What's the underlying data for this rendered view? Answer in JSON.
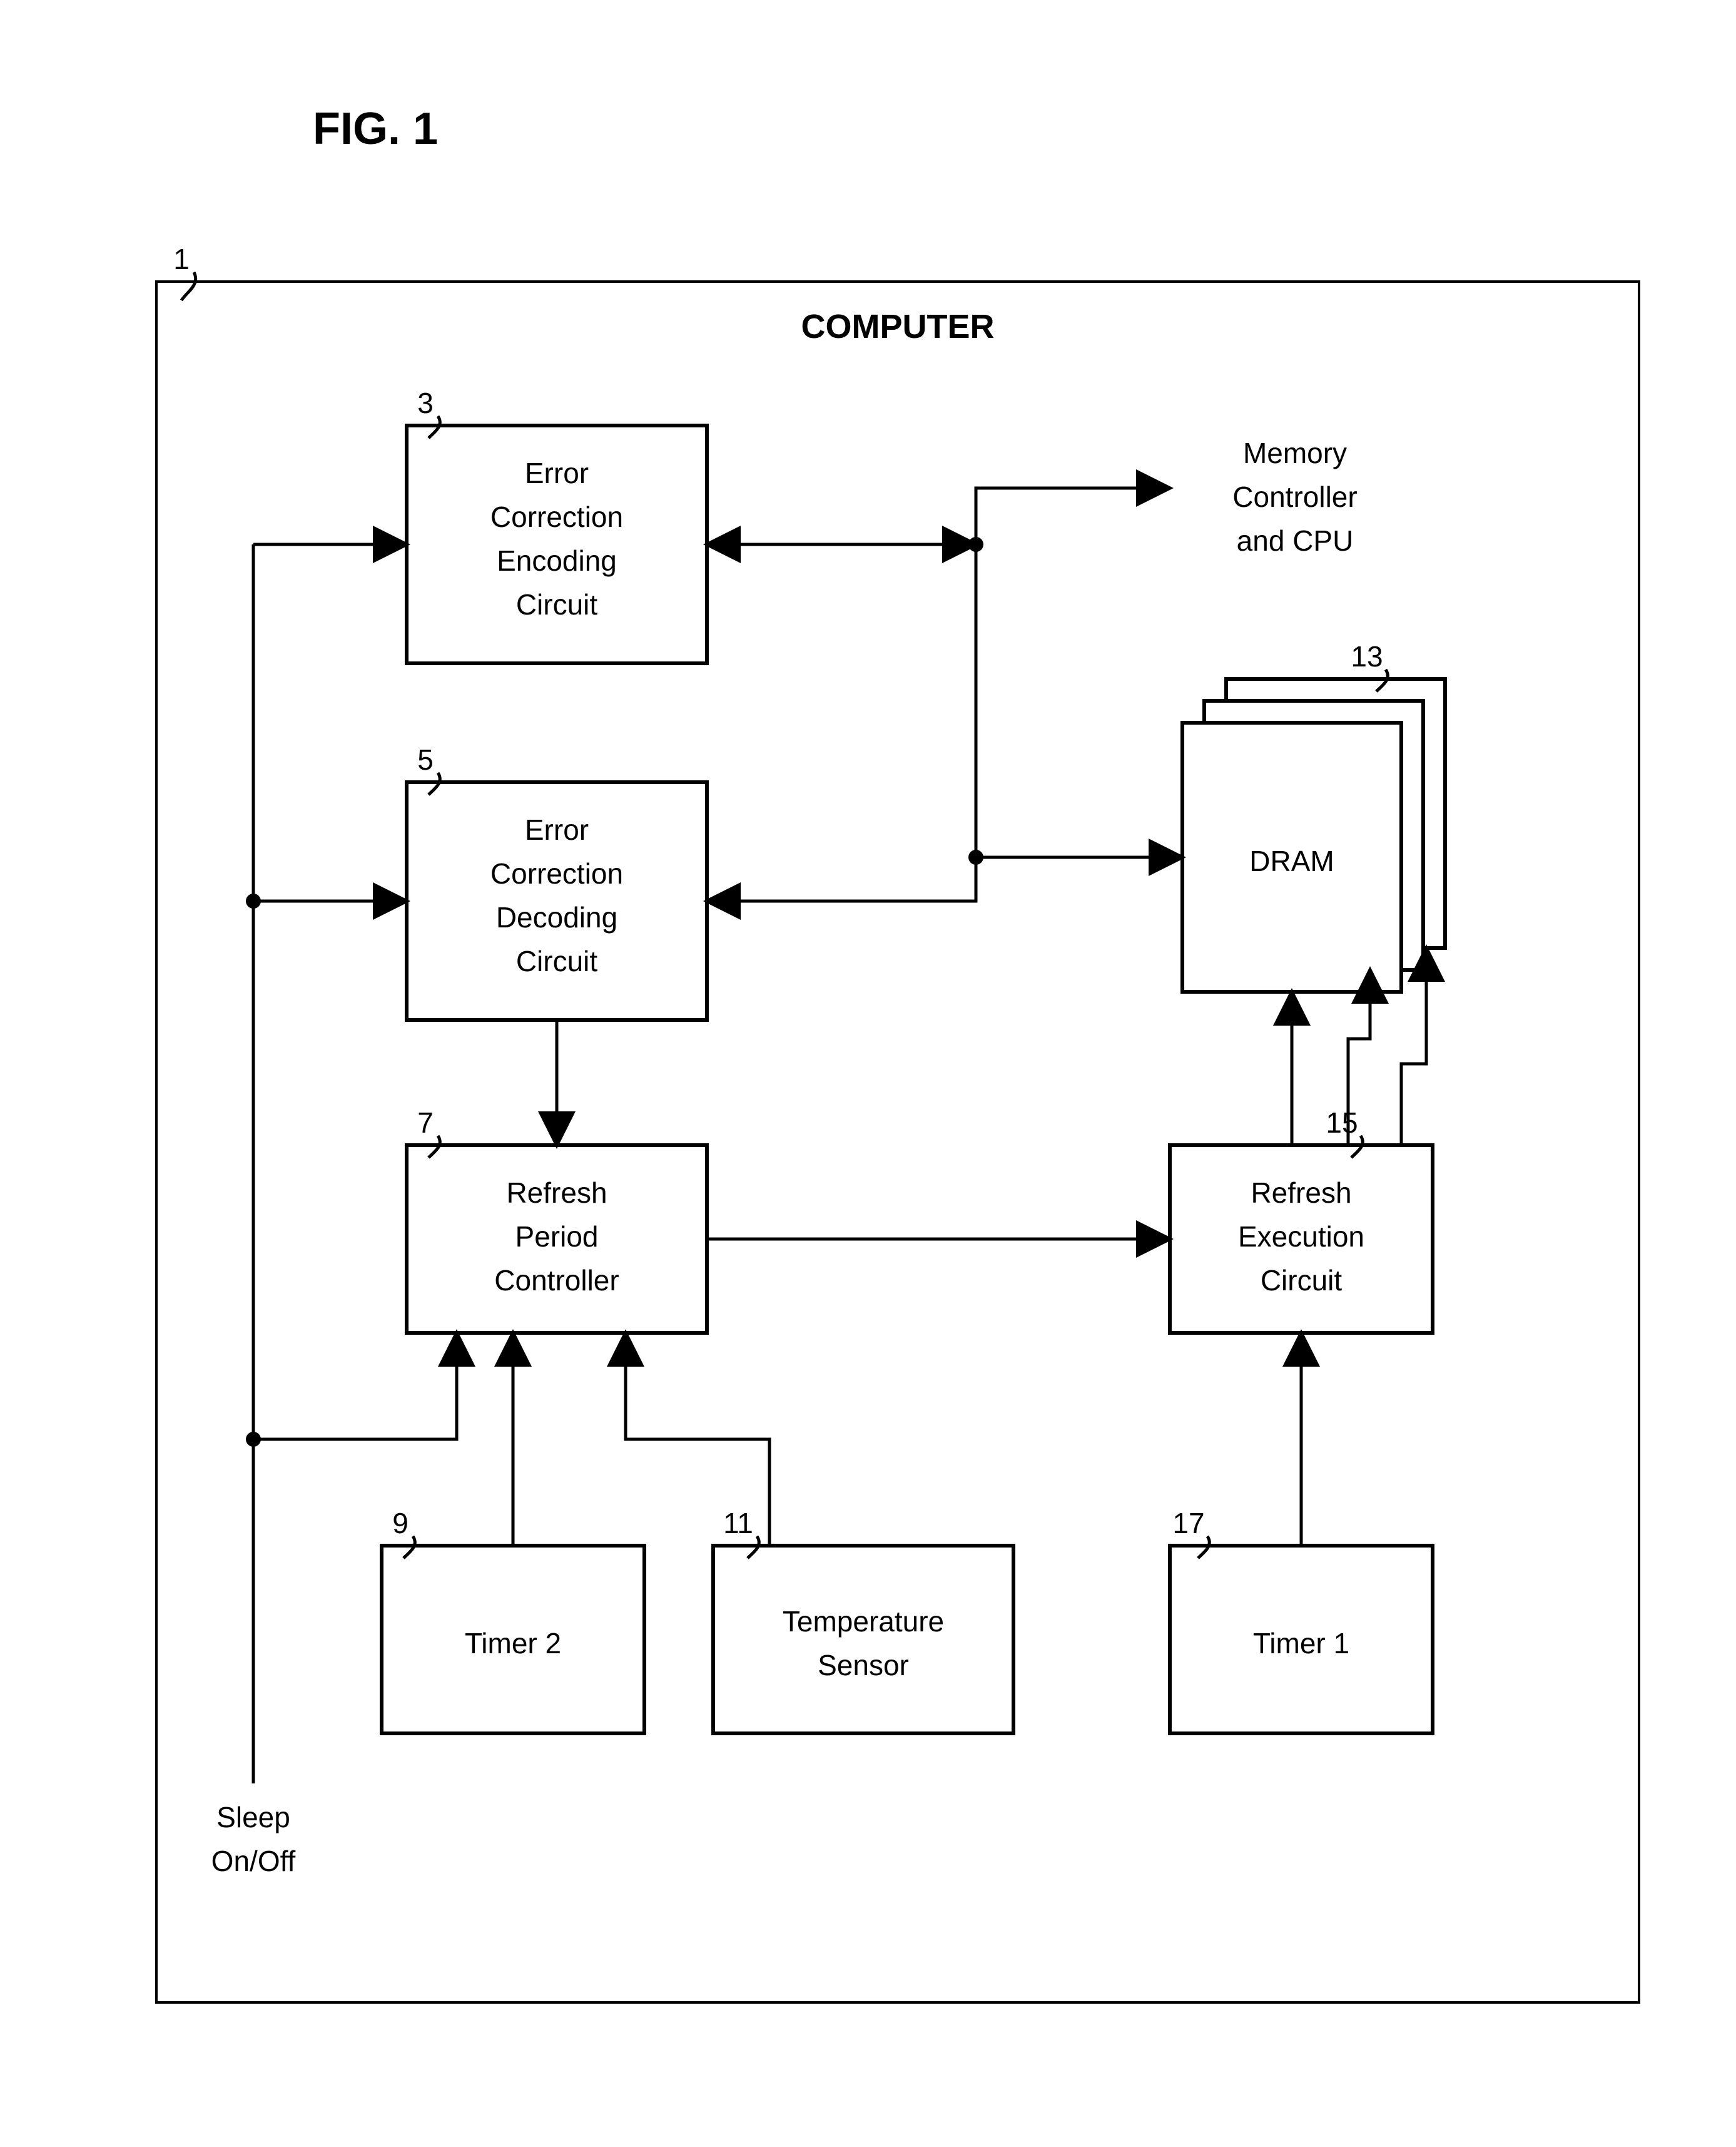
{
  "title": "FIG. 1",
  "outer": {
    "ref": "1",
    "label": "COMPUTER"
  },
  "blocks": {
    "b3": {
      "ref": "3",
      "l1": "Error",
      "l2": "Correction",
      "l3": "Encoding",
      "l4": "Circuit"
    },
    "b5": {
      "ref": "5",
      "l1": "Error",
      "l2": "Correction",
      "l3": "Decoding",
      "l4": "Circuit"
    },
    "b7": {
      "ref": "7",
      "l1": "Refresh",
      "l2": "Period",
      "l3": "Controller"
    },
    "b9": {
      "ref": "9",
      "l1": "Timer 2"
    },
    "b11": {
      "ref": "11",
      "l1": "Temperature",
      "l2": "Sensor"
    },
    "b13": {
      "ref": "13",
      "l1": "DRAM"
    },
    "b15": {
      "ref": "15",
      "l1": "Refresh",
      "l2": "Execution",
      "l3": "Circuit"
    },
    "b17": {
      "ref": "17",
      "l1": "Timer 1"
    }
  },
  "bus_label": {
    "l1": "Memory",
    "l2": "Controller",
    "l3": "and CPU"
  },
  "sleep_label": {
    "l1": "Sleep",
    "l2": "On/Off"
  }
}
